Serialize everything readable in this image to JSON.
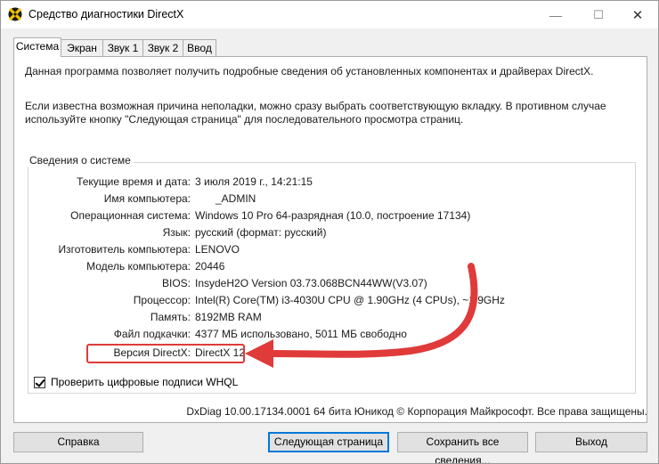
{
  "window": {
    "title": "Средство диагностики DirectX",
    "min_glyph": "—",
    "max_glyph": "☐",
    "close_glyph": "✕"
  },
  "tabs": [
    {
      "label": "Система",
      "active": true
    },
    {
      "label": "Экран",
      "active": false
    },
    {
      "label": "Звук 1",
      "active": false
    },
    {
      "label": "Звук 2",
      "active": false
    },
    {
      "label": "Ввод",
      "active": false
    }
  ],
  "intro": {
    "line1": "Данная программа позволяет получить подробные сведения об установленных компонентах и драйверах DirectX.",
    "line2": "Если известна возможная причина неполадки, можно сразу выбрать соответствующую вкладку. В противном случае используйте кнопку \"Следующая страница\" для последовательного просмотра страниц."
  },
  "system_info": {
    "title": "Сведения о системе",
    "rows": [
      {
        "label": "Текущие время и дата:",
        "value": "3 июля 2019 г., 14:21:15"
      },
      {
        "label": "Имя компьютера:",
        "value": "_ADMIN"
      },
      {
        "label": "Операционная система:",
        "value": "Windows 10 Pro 64-разрядная (10.0, построение 17134)"
      },
      {
        "label": "Язык:",
        "value": "русский (формат: русский)"
      },
      {
        "label": "Изготовитель компьютера:",
        "value": "LENOVO"
      },
      {
        "label": "Модель компьютера:",
        "value": "20446"
      },
      {
        "label": "BIOS:",
        "value": "InsydeH2O Version 03.73.068BCN44WW(V3.07)"
      },
      {
        "label": "Процессор:",
        "value": "Intel(R) Core(TM) i3-4030U CPU @ 1.90GHz (4 CPUs), ~1.9GHz"
      },
      {
        "label": "Память:",
        "value": "8192MB RAM"
      },
      {
        "label": "Файл подкачки:",
        "value": "4377 МБ использовано, 5011 МБ свободно"
      },
      {
        "label": "Версия DirectX:",
        "value": "DirectX 12"
      }
    ]
  },
  "whql_checkbox": {
    "label": "Проверить цифровые подписи WHQL",
    "checked": true
  },
  "footer": "DxDiag 10.00.17134.0001 64 бита Юникод © Корпорация Майкрософт. Все права защищены.",
  "buttons": {
    "help": "Справка",
    "next": "Следующая страница",
    "save": "Сохранить все сведения...",
    "exit": "Выход"
  },
  "colors": {
    "annotation": "#e03a3a",
    "default_button_border": "#0078d7"
  }
}
